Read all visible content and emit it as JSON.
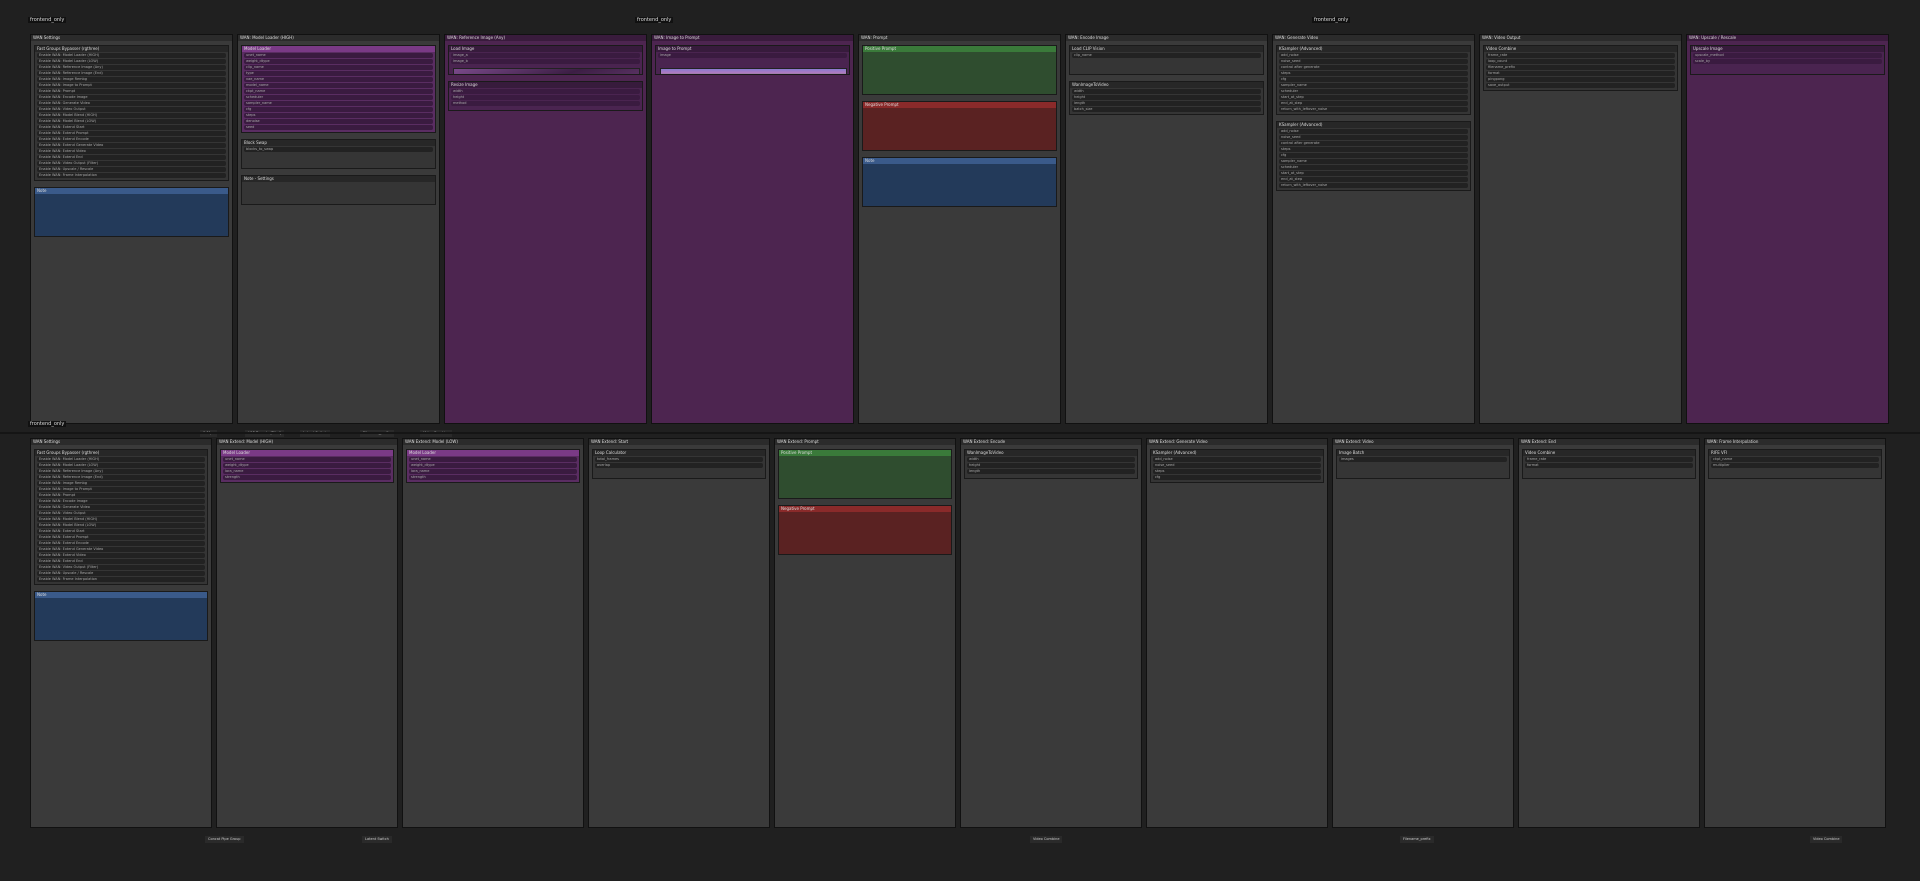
{
  "rows": [
    {
      "id": "top",
      "labels": [
        {
          "text": "frontend_only"
        },
        {
          "text": "frontend_only"
        },
        {
          "text": "frontend_only"
        }
      ],
      "groups": [
        {
          "title": "WAN Settings",
          "color": "dark",
          "nodes": [
            {
              "title": "Fast Groups Bypasser (rgthree)",
              "color": "dark",
              "widgets": [
                "Enable WAN: Model Loader (HIGH)",
                "Enable WAN: Model Loader (LOW)",
                "Enable WAN: Reference Image (Any)",
                "Enable WAN: Reference Image (End)",
                "Enable WAN: Image Rembg",
                "Enable WAN: Image to Prompt",
                "Enable WAN: Prompt",
                "Enable WAN: Encode Image",
                "Enable WAN: Generate Video",
                "Enable WAN: Video Output",
                "Enable WAN: Model Blend (HIGH)",
                "Enable WAN: Model Blend (LOW)",
                "Enable WAN: Extend Start",
                "Enable WAN: Extend Prompt",
                "Enable WAN: Extend Encode",
                "Enable WAN: Extend Generate Video",
                "Enable WAN: Extend Video",
                "Enable WAN: Extend End",
                "Enable WAN: Video Output (Filter)",
                "Enable WAN: Upscale / Rescale",
                "Enable WAN: Frame Interpolation"
              ]
            },
            {
              "title": "Note",
              "color": "blue",
              "widgets": []
            }
          ]
        },
        {
          "title": "WAN: Model Loader (HIGH)",
          "color": "dark",
          "nodes": [
            {
              "title": "Model Loader",
              "color": "purple",
              "widgets": [
                "unet_name",
                "weight_dtype",
                "clip_name",
                "type",
                "vae_name",
                "model_name",
                "ckpt_name",
                "scheduler",
                "sampler_name",
                "cfg",
                "steps",
                "denoise",
                "seed"
              ]
            },
            {
              "title": "Block Swap",
              "color": "dark",
              "widgets": [
                "blocks_to_swap"
              ]
            },
            {
              "title": "Note - Settings",
              "color": "dark",
              "widgets": []
            }
          ]
        },
        {
          "title": "WAN: Reference Image (Any)",
          "color": "purple",
          "nodes": [
            {
              "title": "Load Image",
              "color": "purpledark",
              "widgets": [
                "image_a",
                "image_b"
              ]
            },
            {
              "title": "Resize Image",
              "color": "purpledark",
              "widgets": [
                "width",
                "height",
                "method"
              ]
            }
          ]
        },
        {
          "title": "WAN: Image to Prompt",
          "color": "purple",
          "nodes": [
            {
              "title": "Image to Prompt",
              "color": "purpledark",
              "widgets": [
                "image"
              ]
            }
          ]
        },
        {
          "title": "WAN: Prompt",
          "color": "dark",
          "nodes": [
            {
              "title": "Positive Prompt",
              "color": "green",
              "widgets": []
            },
            {
              "title": "Negative Prompt",
              "color": "red",
              "widgets": []
            },
            {
              "title": "Note",
              "color": "blue",
              "widgets": []
            }
          ]
        },
        {
          "title": "WAN: Encode Image",
          "color": "dark",
          "nodes": [
            {
              "title": "Load CLIP Vision",
              "color": "dark",
              "widgets": [
                "clip_name"
              ]
            },
            {
              "title": "WanImageToVideo",
              "color": "dark",
              "widgets": [
                "width",
                "height",
                "length",
                "batch_size"
              ]
            }
          ]
        },
        {
          "title": "WAN: Generate Video",
          "color": "dark",
          "nodes": [
            {
              "title": "KSampler (Advanced)",
              "color": "dark",
              "widgets": [
                "add_noise",
                "noise_seed",
                "control after generate",
                "steps",
                "cfg",
                "sampler_name",
                "scheduler",
                "start_at_step",
                "end_at_step",
                "return_with_leftover_noise"
              ]
            },
            {
              "title": "KSampler (Advanced)",
              "color": "dark",
              "widgets": [
                "add_noise",
                "noise_seed",
                "control after generate",
                "steps",
                "cfg",
                "sampler_name",
                "scheduler",
                "start_at_step",
                "end_at_step",
                "return_with_leftover_noise"
              ]
            }
          ]
        },
        {
          "title": "WAN: Video Output",
          "color": "dark",
          "nodes": [
            {
              "title": "Video Combine",
              "color": "dark",
              "widgets": [
                "frame_rate",
                "loop_count",
                "filename_prefix",
                "format",
                "pingpong",
                "save_output"
              ]
            }
          ]
        },
        {
          "title": "WAN: Upscale / Rescale",
          "color": "purple",
          "nodes": [
            {
              "title": "Upscale Image",
              "color": "purpledark",
              "widgets": [
                "upscale_method",
                "scale_by"
              ]
            }
          ]
        }
      ],
      "bottom_labels": [
        "0.0fps",
        "VAE Decode (Tiled)",
        "Latent Switch",
        "Filename_prefix",
        "Video Combine"
      ]
    },
    {
      "id": "bottom",
      "labels": [
        {
          "text": "frontend_only"
        }
      ],
      "groups": [
        {
          "title": "WAN Settings",
          "color": "dark",
          "nodes": [
            {
              "title": "Fast Groups Bypasser (rgthree)",
              "color": "dark",
              "widgets": [
                "Enable WAN: Model Loader (HIGH)",
                "Enable WAN: Model Loader (LOW)",
                "Enable WAN: Reference Image (Any)",
                "Enable WAN: Reference Image (End)",
                "Enable WAN: Image Rembg",
                "Enable WAN: Image to Prompt",
                "Enable WAN: Prompt",
                "Enable WAN: Encode Image",
                "Enable WAN: Generate Video",
                "Enable WAN: Video Output",
                "Enable WAN: Model Blend (HIGH)",
                "Enable WAN: Model Blend (LOW)",
                "Enable WAN: Extend Start",
                "Enable WAN: Extend Prompt",
                "Enable WAN: Extend Encode",
                "Enable WAN: Extend Generate Video",
                "Enable WAN: Extend Video",
                "Enable WAN: Extend End",
                "Enable WAN: Video Output (Filter)",
                "Enable WAN: Upscale / Rescale",
                "Enable WAN: Frame Interpolation"
              ]
            },
            {
              "title": "Note",
              "color": "blue",
              "widgets": []
            }
          ]
        },
        {
          "title": "WAN Extend: Model (HIGH)",
          "color": "dark",
          "nodes": [
            {
              "title": "Model Loader",
              "color": "purple",
              "widgets": [
                "unet_name",
                "weight_dtype",
                "lora_name",
                "strength"
              ]
            }
          ]
        },
        {
          "title": "WAN Extend: Model (LOW)",
          "color": "dark",
          "nodes": [
            {
              "title": "Model Loader",
              "color": "purple",
              "widgets": [
                "unet_name",
                "weight_dtype",
                "lora_name",
                "strength"
              ]
            }
          ]
        },
        {
          "title": "WAN Extend: Start",
          "color": "dark",
          "nodes": [
            {
              "title": "Loop Calculator",
              "color": "dark",
              "widgets": [
                "total_frames",
                "overlap"
              ]
            }
          ]
        },
        {
          "title": "WAN Extend: Prompt",
          "color": "dark",
          "nodes": [
            {
              "title": "Positive Prompt",
              "color": "green",
              "widgets": []
            },
            {
              "title": "Negative Prompt",
              "color": "red",
              "widgets": []
            }
          ]
        },
        {
          "title": "WAN Extend: Encode",
          "color": "dark",
          "nodes": [
            {
              "title": "WanImageToVideo",
              "color": "dark",
              "widgets": [
                "width",
                "height",
                "length"
              ]
            }
          ]
        },
        {
          "title": "WAN Extend: Generate Video",
          "color": "dark",
          "nodes": [
            {
              "title": "KSampler (Advanced)",
              "color": "dark",
              "widgets": [
                "add_noise",
                "noise_seed",
                "steps",
                "cfg"
              ]
            }
          ]
        },
        {
          "title": "WAN Extend: Video",
          "color": "dark",
          "nodes": [
            {
              "title": "Image Batch",
              "color": "dark",
              "widgets": [
                "images"
              ]
            }
          ]
        },
        {
          "title": "WAN Extend: End",
          "color": "dark",
          "nodes": [
            {
              "title": "Video Combine",
              "color": "dark",
              "widgets": [
                "frame_rate",
                "format"
              ]
            }
          ]
        },
        {
          "title": "WAN: Frame Interpolation",
          "color": "dark",
          "nodes": [
            {
              "title": "RIFE VFI",
              "color": "dark",
              "widgets": [
                "ckpt_name",
                "multiplier"
              ]
            }
          ]
        }
      ],
      "bottom_labels": [
        "Concat Pipe Group",
        "Latent Switch",
        "Video Combine",
        "Filename_prefix",
        "Video Combine"
      ]
    }
  ]
}
